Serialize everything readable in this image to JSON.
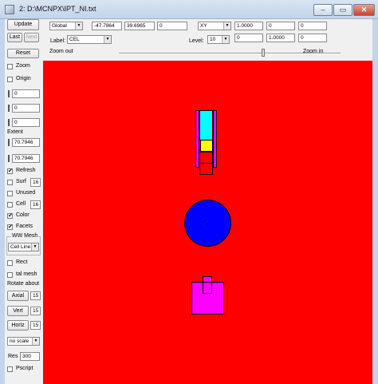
{
  "window": {
    "title": "2: D:\\MCNPX\\IPT_NI.txt",
    "min_glyph": "–",
    "max_glyph": "▭",
    "close_glyph": "✕"
  },
  "sidebar": {
    "update": "Update",
    "last": "Last",
    "next": "Next",
    "reset": "Reset",
    "zoom": "Zoom",
    "origin": "Origin",
    "origin_vals": [
      "0",
      "0",
      "0"
    ],
    "extent": "Extent",
    "extent_vals": [
      "70.7946",
      "70.7946"
    ],
    "refresh": "Refresh",
    "refresh_checked": "✔",
    "surf": "Surf",
    "surf_val": "16",
    "unused": "Unused",
    "cell": "Cell",
    "cell_val": "16",
    "color": "Color",
    "color_checked": "✔",
    "facets": "Facets",
    "facets_checked": "✔",
    "ww_mesh": "WW Mesh",
    "cell_line": "Cell Line",
    "rect": "Rect",
    "tal_mesh": "tal mesh",
    "rotate_about": "Rotate about",
    "axial": "Axial",
    "axial_val": "15",
    "vert": "Vert",
    "vert_val": "15",
    "horiz": "Horiz",
    "horiz_val": "15",
    "scale": "no scale",
    "res_label": "Res",
    "res_val": "300",
    "pscript": "Pscript"
  },
  "toolbar": {
    "coord_system": "Global",
    "coords": [
      "-47.7864",
      "39.6965",
      "0"
    ],
    "plane": "XY",
    "plane_vals_row1": [
      "1.0000",
      "0",
      "0"
    ],
    "plane_vals_row2": [
      "0",
      "1.0000",
      "0"
    ],
    "label_caption": "Label:",
    "label_value": "CEL",
    "level_caption": "Level:",
    "level_value": "10",
    "zoom_out": "Zoom out",
    "zoom_in": "Zoom in",
    "zoom_level": 0.65
  },
  "canvas": {
    "background": "#ff0000",
    "colors": {
      "cyan": "#00ffff",
      "yellow": "#ffff00",
      "magenta": "#ff00ff",
      "blue": "#0000ff",
      "outline": "#000000"
    }
  }
}
